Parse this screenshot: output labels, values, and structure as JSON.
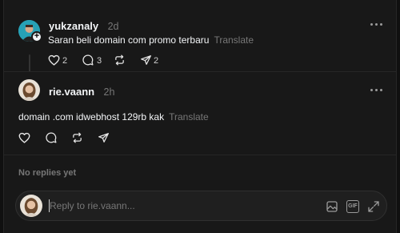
{
  "post": {
    "username": "yukzanaly",
    "time": "2d",
    "text": "Saran beli domain com promo terbaru",
    "translate": "Translate",
    "like_count": "2",
    "reply_count": "3",
    "share_count": "2"
  },
  "reply": {
    "username": "rie.vaann",
    "time": "2h",
    "text": "domain .com idwebhost 129rb kak",
    "translate": "Translate"
  },
  "no_replies": "No replies yet",
  "composer": {
    "placeholder": "Reply to rie.vaann...",
    "gif_label": "GIF"
  },
  "icons": {
    "like": "heart-icon",
    "comment": "comment-icon",
    "repost": "repost-icon",
    "share": "send-icon",
    "more": "more-icon",
    "image": "image-icon",
    "expand": "expand-icon"
  }
}
